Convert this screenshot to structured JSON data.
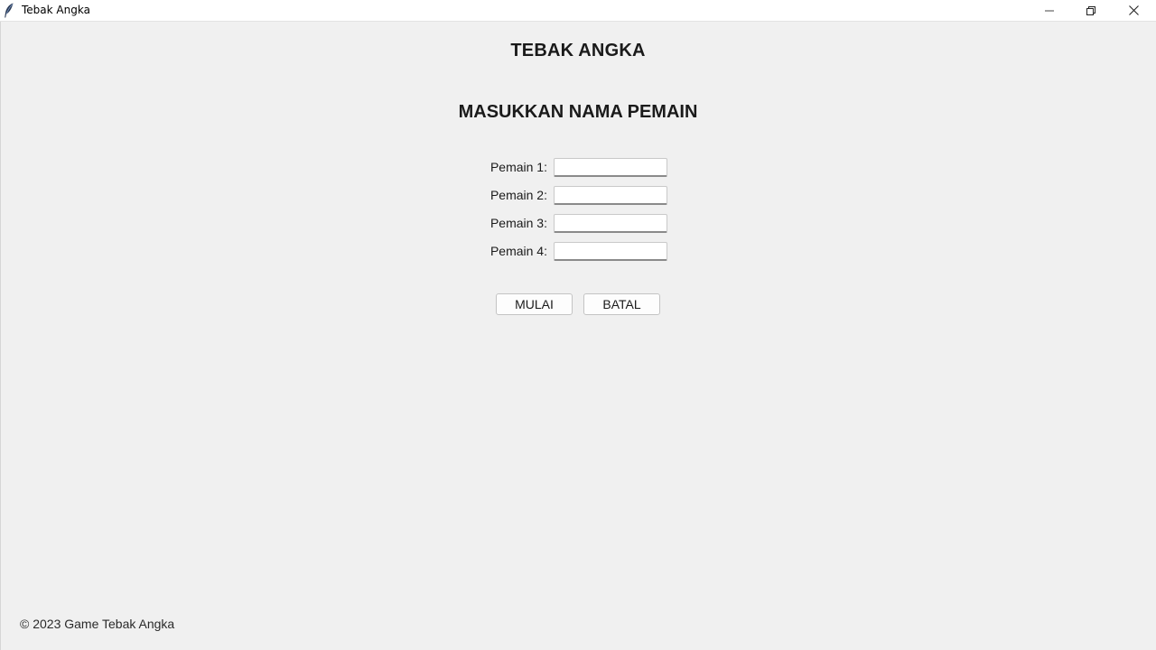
{
  "window": {
    "title": "Tebak Angka",
    "app_icon": "feather-icon",
    "controls": {
      "minimize_icon": "minimize-icon",
      "maximize_icon": "restore-icon",
      "close_icon": "close-icon"
    }
  },
  "header": {
    "title": "TEBAK ANGKA",
    "subtitle": "MASUKKAN NAMA PEMAIN"
  },
  "players": [
    {
      "label": "Pemain 1:",
      "value": ""
    },
    {
      "label": "Pemain 2:",
      "value": ""
    },
    {
      "label": "Pemain 3:",
      "value": ""
    },
    {
      "label": "Pemain 4:",
      "value": ""
    }
  ],
  "actions": {
    "start_label": "MULAI",
    "cancel_label": "BATAL"
  },
  "footer": {
    "copyright": "© 2023 Game Tebak Angka"
  },
  "colors": {
    "background": "#f0f0f0",
    "titlebar": "#ffffff",
    "text": "#1a1a1a"
  }
}
